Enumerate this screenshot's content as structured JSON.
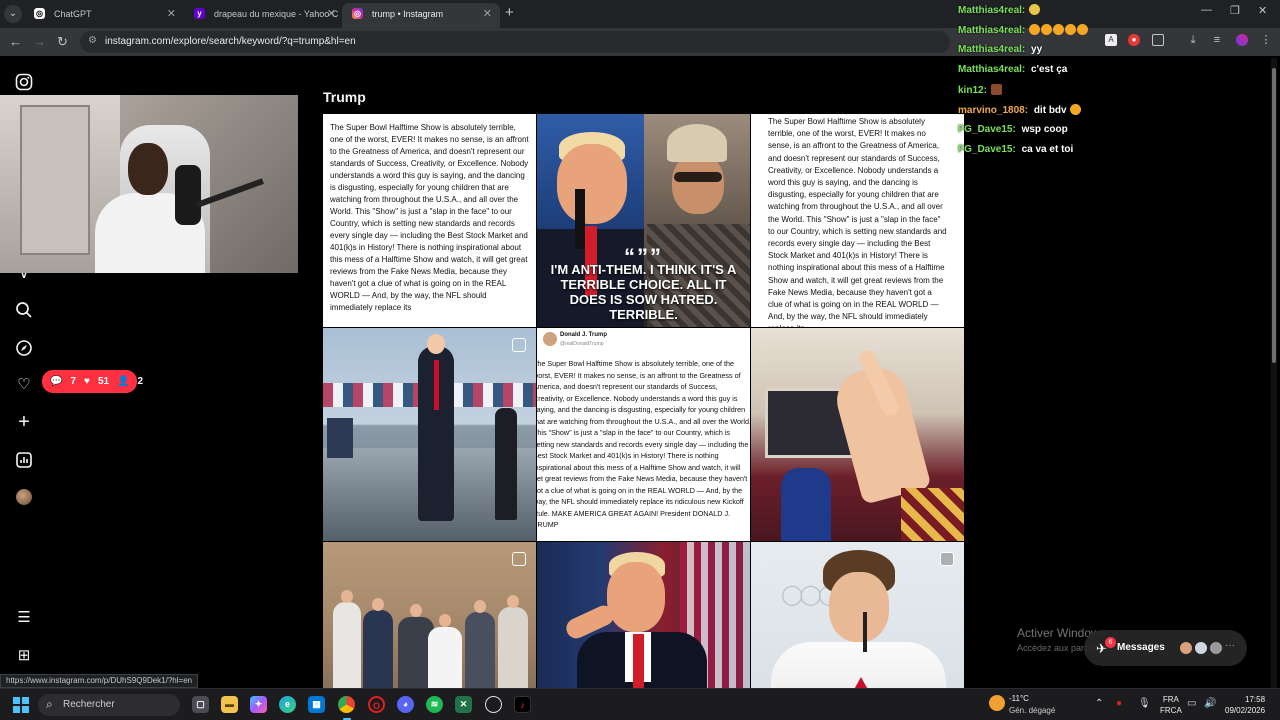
{
  "browser": {
    "tabs": [
      {
        "title": "ChatGPT",
        "icon": "chatgpt-icon",
        "active": false
      },
      {
        "title": "drapeau du mexique - Yahoo C",
        "icon": "yahoo-icon",
        "active": false
      },
      {
        "title": "trump • Instagram",
        "icon": "instagram-icon",
        "active": true
      }
    ],
    "url": "instagram.com/explore/search/keyword/?q=trump&hl=en"
  },
  "instagram": {
    "search_title": "Trump",
    "notifications": {
      "comments": "7",
      "likes": "51",
      "follows": "2"
    },
    "posts": {
      "p1_text": "The Super Bowl Halftime Show is absolutely terrible, one of the worst, EVER! It makes no sense, is an affront to the Greatness of America, and doesn't represent our standards of Success, Creativity, or Excellence. Nobody understands a word this guy is saying, and the dancing is disgusting, especially for young children that are watching from throughout the U.S.A., and all over the World. This \"Show\" is just a \"slap in the face\" to our Country, which is setting new standards and records every single day — including the Best Stock Market and 401(k)s in History! There is nothing inspirational about this mess of a Halftime Show and watch, it will get great reviews from the Fake News Media, because they haven't got a clue of what is going on in the REAL WORLD — And, by the way, the NFL should immediately replace its",
      "p2_quote_mark": "“””",
      "p2_quote": "I'M ANTI-THEM. I THINK IT'S A TERRIBLE CHOICE. ALL IT DOES IS SOW HATRED. TERRIBLE.",
      "p3_text": "The Super Bowl Halftime Show is absolutely terrible, one of the worst, EVER! It makes no sense, is an affront to the Greatness of America, and doesn't represent our standards of Success, Creativity, or Excellence. Nobody understands a word this guy is saying, and the dancing is disgusting, especially for young children that are watching from throughout the U.S.A., and all over the World. This \"Show\" is just a \"slap in the face\" to our Country, which is setting new standards and records every single day — including the Best Stock Market and 401(k)s in History! There is nothing inspirational about this mess of a Halftime Show and watch, it will get great reviews from the Fake News Media, because they haven't got a clue of what is going on in the REAL WORLD — And, by the way, the NFL should immediately replace its",
      "p5_name": "Donald J. Trump",
      "p5_handle": "@realDonaldTrump",
      "p5_text": "The Super Bowl Halftime Show is absolutely terrible, one of the worst, EVER! It makes no sense, is an affront to the Greatness of America, and doesn't represent our standards of Success, Creativity, or Excellence. Nobody understands a word this guy is saying, and the dancing is disgusting, especially for young children that are watching from throughout the U.S.A., and all over the World. This \"Show\" is just a \"slap in the face\" to our Country, which is setting new standards and records every single day — including the Best Stock Market and 401(k)s in History! There is nothing inspirational about this mess of a Halftime Show and watch, it will get great reviews from the Fake News Media, because they haven't got a clue of what is going on in the REAL WORLD — And, by the way, the NFL should immediately replace its ridiculous new Kickoff Rule. MAKE AMERICA GREAT AGAIN! President DONALD J. TRUMP"
    },
    "messages_label": "Messages",
    "messages_badge": "6",
    "status_url": "https://www.instagram.com/p/DUhS9Q9Dek1/?hl=en"
  },
  "chat": [
    {
      "user": "Matthias4real:",
      "msg": "",
      "color": "#7be05a"
    },
    {
      "user": "Matthias4real:",
      "msg": "",
      "color": "#7be05a"
    },
    {
      "user": "Matthias4real:",
      "msg": "yy",
      "color": "#7be05a"
    },
    {
      "user": "Matthias4real:",
      "msg": "c'est ça",
      "color": "#7be05a"
    },
    {
      "user": "kin12:",
      "msg": "",
      "color": "#7be05a"
    },
    {
      "user": "marvino_1808:",
      "msg": "dit bdv",
      "color": "#f0a94a"
    },
    {
      "user": "FG_Dave15:",
      "msg": "wsp coop",
      "color": "#7be05a"
    },
    {
      "user": "FG_Dave15:",
      "msg": "ca va et toi",
      "color": "#7be05a"
    }
  ],
  "watermark": {
    "title": "Activer Windows",
    "sub": "Accédez aux paramètres"
  },
  "taskbar": {
    "search_placeholder": "Rechercher",
    "weather_temp": "-11°C",
    "weather_desc": "Gén. dégagé",
    "lang_top": "FRA",
    "lang_bottom": "FRCA",
    "time": "17:58",
    "date": "09/02/2026"
  }
}
